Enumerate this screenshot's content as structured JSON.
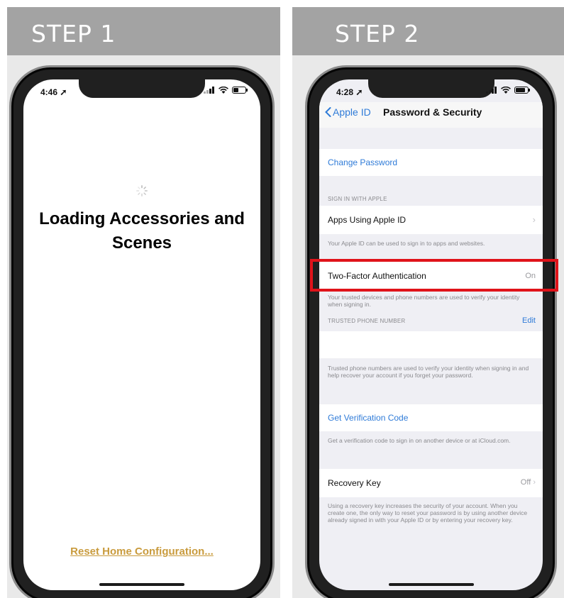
{
  "step1": {
    "banner": "STEP 1",
    "status_time": "4:46",
    "loading_title": "Loading Accessories and Scenes",
    "reset_link": "Reset Home Configuration..."
  },
  "step2": {
    "banner": "STEP 2",
    "status_time": "4:28",
    "nav": {
      "back_label": "Apple ID",
      "title": "Password & Security"
    },
    "change_password": "Change Password",
    "sign_in_header": "SIGN IN WITH APPLE",
    "apps_using": "Apps Using Apple ID",
    "apps_footer": "Your Apple ID can be used to sign in to apps and websites.",
    "two_factor": {
      "label": "Two-Factor Authentication",
      "value": "On"
    },
    "two_factor_footer": "Your trusted devices and phone numbers are used to verify your identity when signing in.",
    "trusted_header": "TRUSTED PHONE NUMBER",
    "edit_label": "Edit",
    "trusted_footer": "Trusted phone numbers are used to verify your identity when signing in and help recover your account if you forget your password.",
    "get_code": "Get Verification Code",
    "get_code_footer": "Get a verification code to sign in on another device or at iCloud.com.",
    "recovery": {
      "label": "Recovery Key",
      "value": "Off"
    },
    "recovery_footer": "Using a recovery key increases the security of your account. When you create one, the only way to reset your password is by using another device already signed in with your Apple ID or by entering your recovery key."
  },
  "colors": {
    "link_blue": "#2f7bd8",
    "highlight_red": "#e0131a",
    "reset_gold": "#c99b3d",
    "banner_gray": "#a3a3a3"
  },
  "icons": [
    "location-arrow-icon",
    "cellular-signal-icon",
    "wifi-icon",
    "battery-icon",
    "spinner-icon",
    "chevron-left-icon",
    "chevron-right-icon"
  ]
}
